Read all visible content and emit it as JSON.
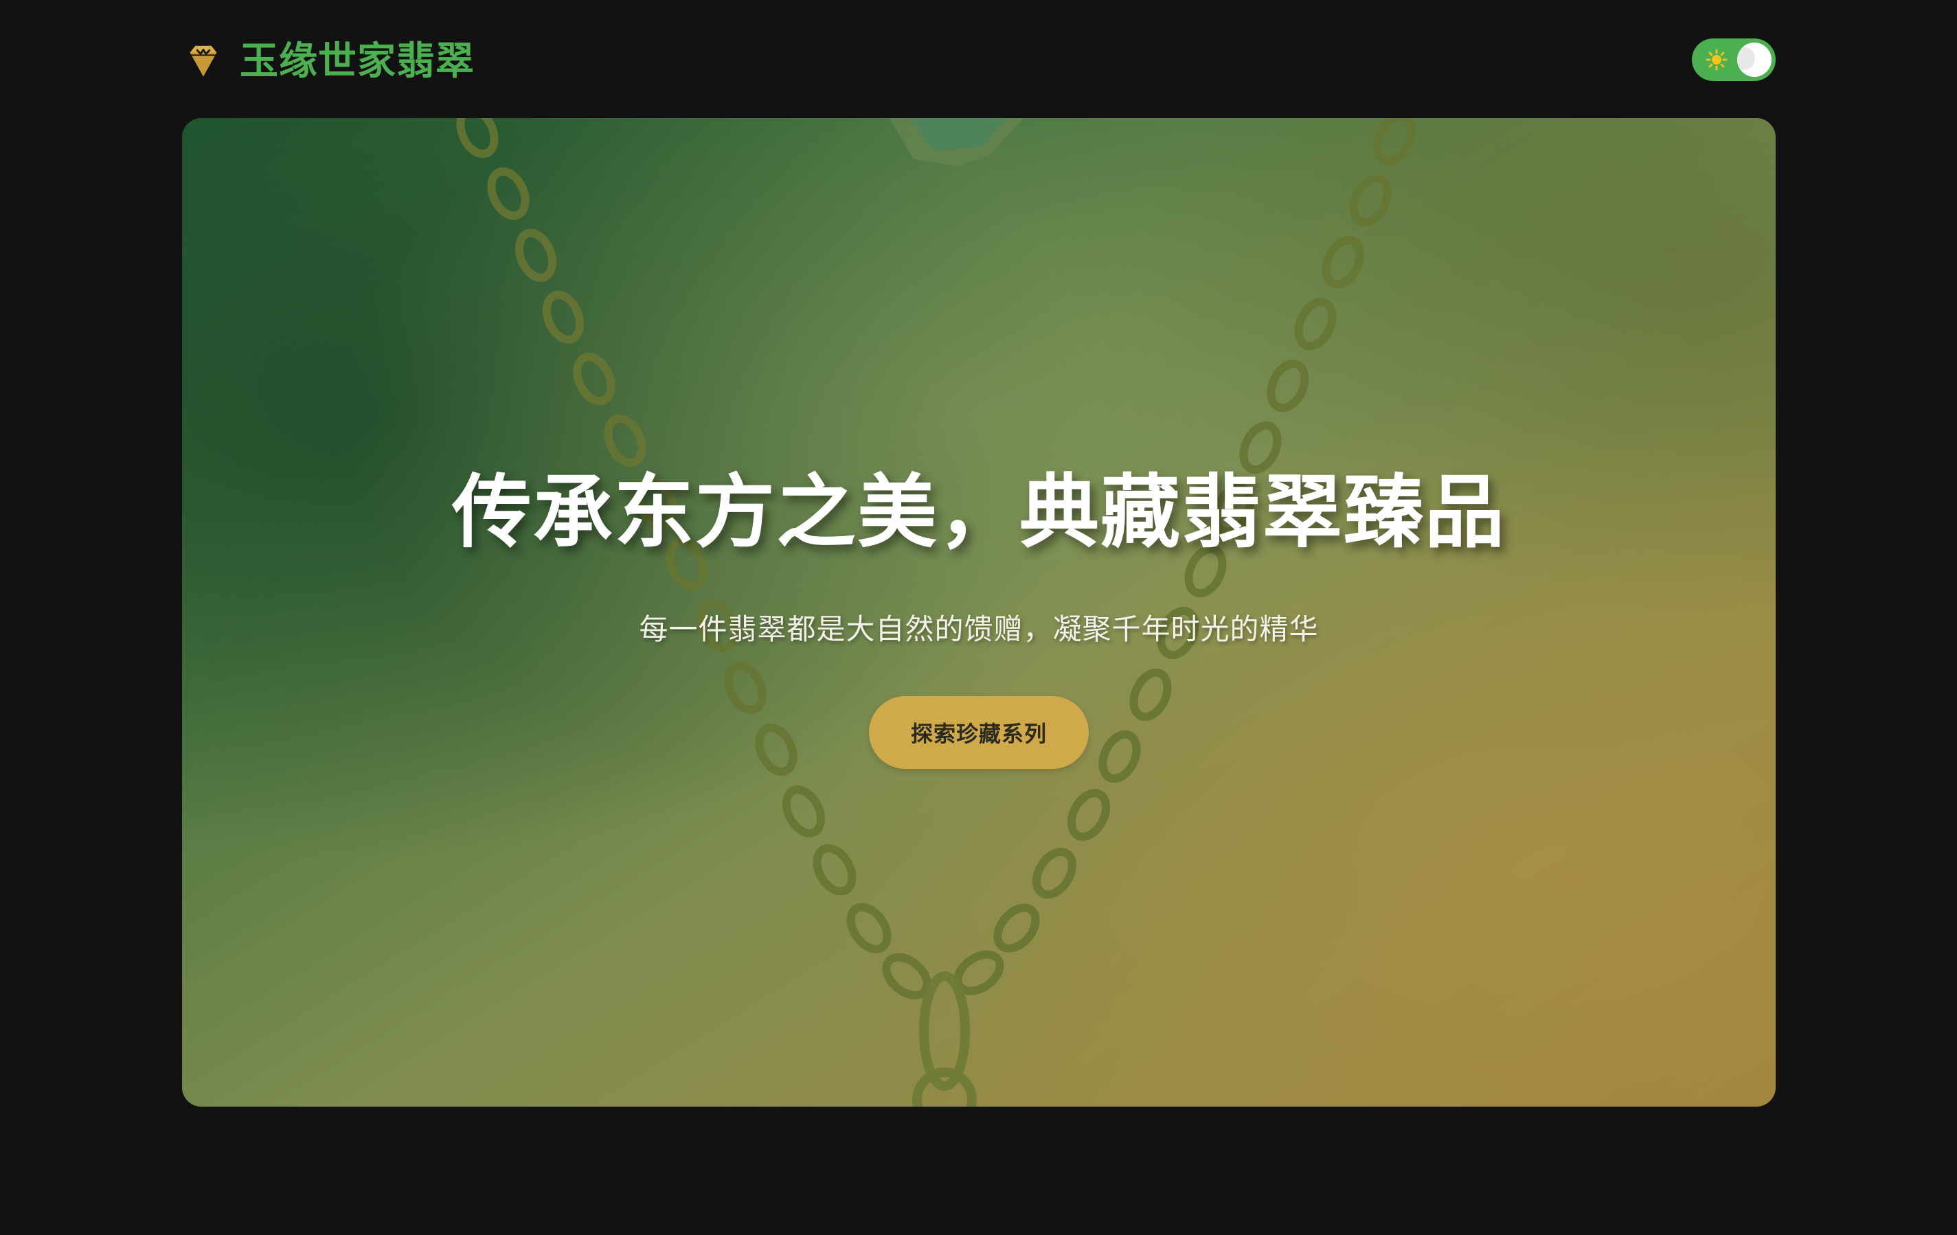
{
  "header": {
    "brand_name": "玉缘世家翡翠",
    "brand_icon": "gem-icon",
    "theme_toggle": {
      "icon_sun": "sun-icon",
      "icon_moon": "moon-icon",
      "state": "dark"
    }
  },
  "hero": {
    "title": "传承东方之美，典藏翡翠臻品",
    "subtitle": "每一件翡翠都是大自然的馈赠，凝聚千年时光的精华",
    "cta_label": "探索珍藏系列",
    "background_image": "jade-necklace-chain-photo"
  },
  "colors": {
    "page_background": "#121212",
    "brand_green": "#4caf50",
    "accent_gold": "#cfa94a",
    "hero_text": "#ffffff"
  }
}
